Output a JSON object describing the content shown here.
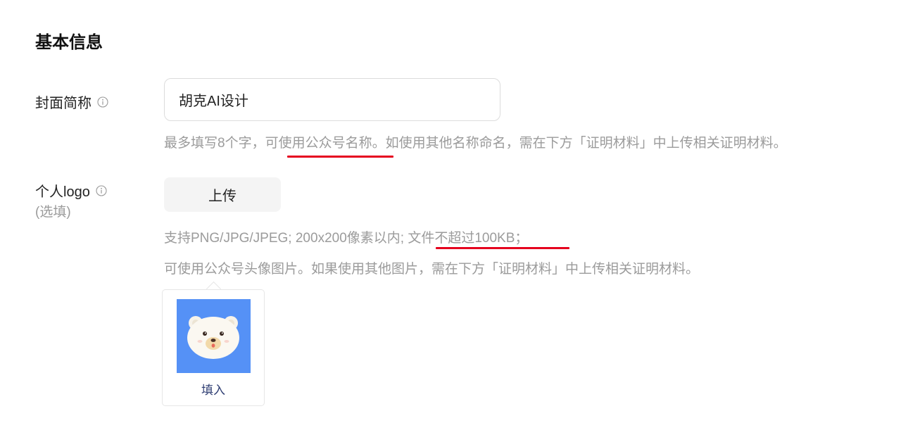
{
  "section": {
    "title": "基本信息"
  },
  "cover_name": {
    "label": "封面简称",
    "input_value": "胡克AI设计",
    "hint_prefix": "最多填写8个字，",
    "hint_highlight": "可使用公众号名称",
    "hint_suffix": "。如使用其他名称命名，需在下方「证明材料」中上传相关证明材料。"
  },
  "logo": {
    "label": "个人logo",
    "sublabel": "(选填)",
    "upload_label": "上传",
    "hint1_prefix": "支持PNG/JPG/JPEG; 200x200像素以内",
    "hint1_highlight": "; 文件不超过100KB",
    "hint1_suffix": "；",
    "hint2": "可使用公众号头像图片。如果使用其他图片，需在下方「证明材料」中上传相关证明材料。",
    "popover_action": "填入"
  },
  "colors": {
    "accent_underline": "#e5001e",
    "avatar_bg": "#5591f6",
    "hint_text": "#9b9b9b"
  },
  "icons": [
    "info-icon",
    "bear-avatar-icon"
  ]
}
